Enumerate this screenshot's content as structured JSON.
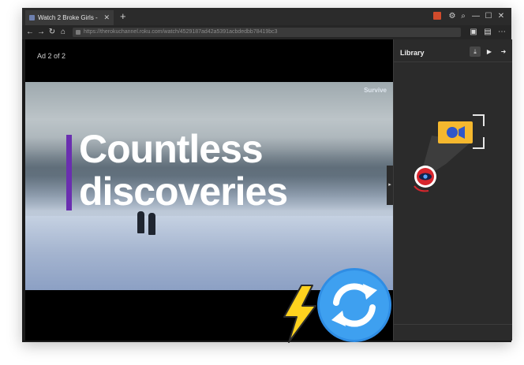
{
  "browser": {
    "tab_title": "Watch 2 Broke Girls - ",
    "tab_close": "✕",
    "new_tab": "+",
    "url": "https://therokuchannel.roku.com/watch/4529187ad42a5391acbdedbb78419bc3"
  },
  "player": {
    "ad_label": "Ad 2 of 2",
    "channel_label": "Survive",
    "headline_line1": "Countless",
    "headline_line2": "discoveries"
  },
  "sidebar": {
    "title": "Library"
  },
  "icons": {
    "gift": "gift-icon",
    "back": "arrow-left-icon",
    "forward": "arrow-right-icon",
    "reload": "reload-icon",
    "home": "home-icon",
    "download": "download-icon",
    "video": "video-icon",
    "logout": "sign-out-icon",
    "overlay_bolt": "lightning-icon",
    "overlay_sync": "sync-icon"
  },
  "colors": {
    "accent_purple": "#6a2fb0",
    "sync_blue": "#2f8de4",
    "bolt_yellow": "#ffd21e",
    "camera_yellow": "#f5b82e"
  }
}
